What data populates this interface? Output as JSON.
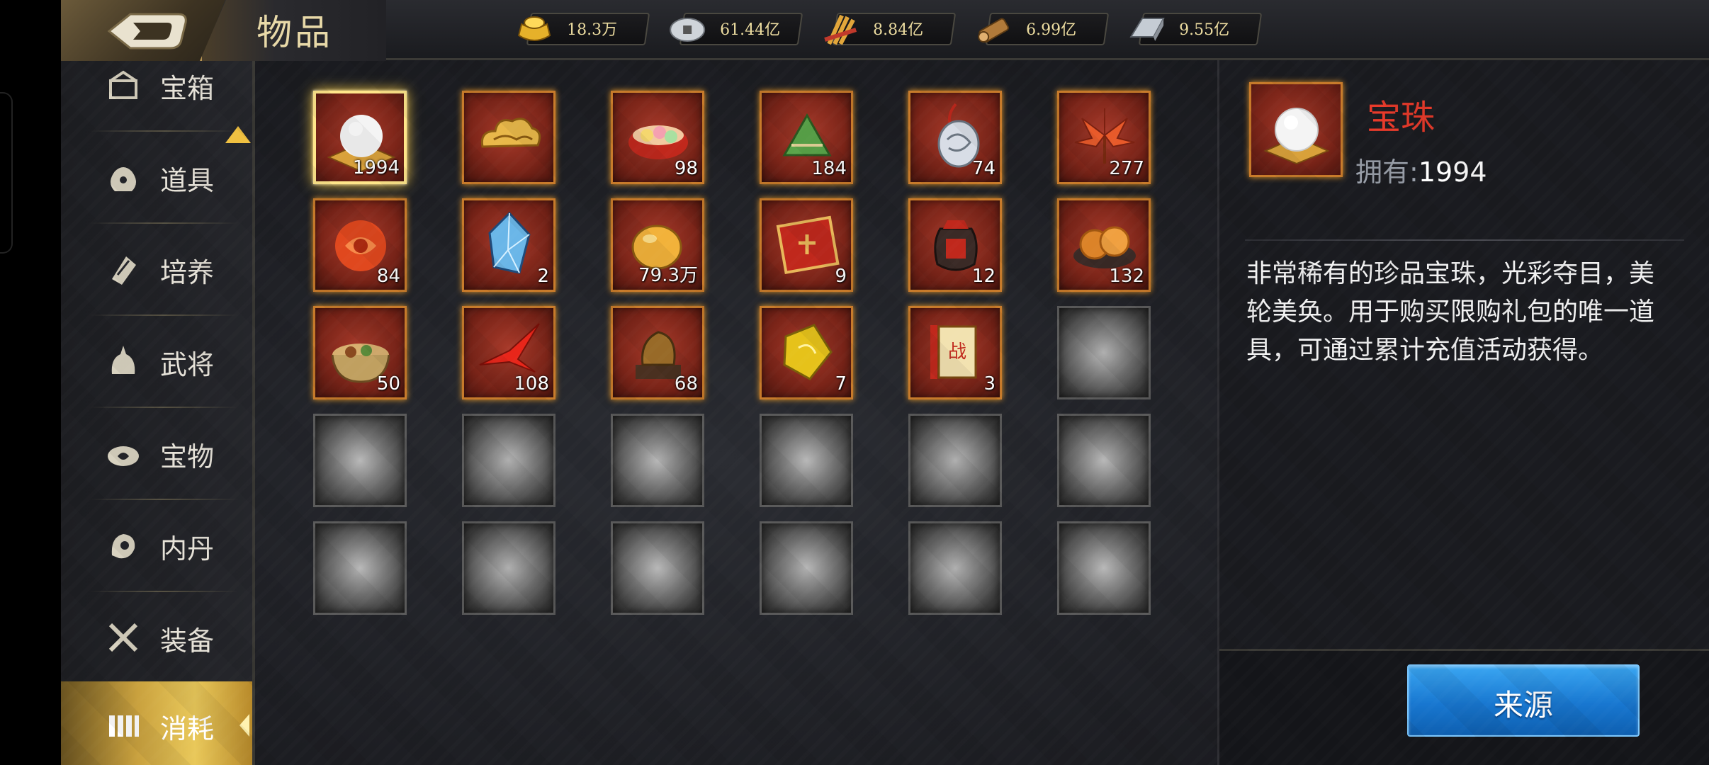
{
  "header": {
    "title": "物品",
    "resources": [
      {
        "icon": "gold-ingot-icon",
        "value": "18.3万"
      },
      {
        "icon": "silver-coin-icon",
        "value": "61.44亿"
      },
      {
        "icon": "grain-icon",
        "value": "8.84亿"
      },
      {
        "icon": "wood-icon",
        "value": "6.99亿"
      },
      {
        "icon": "iron-icon",
        "value": "9.55亿"
      }
    ]
  },
  "sidebar": {
    "items": [
      {
        "label": "宝箱",
        "icon": "chest-icon"
      },
      {
        "label": "道具",
        "icon": "pouch-icon"
      },
      {
        "label": "培养",
        "icon": "scroll-icon"
      },
      {
        "label": "武将",
        "icon": "helmet-icon"
      },
      {
        "label": "宝物",
        "icon": "treasure-icon"
      },
      {
        "label": "内丹",
        "icon": "elixir-icon"
      },
      {
        "label": "装备",
        "icon": "swords-icon"
      },
      {
        "label": "消耗",
        "icon": "consumable-icon",
        "active": true
      }
    ]
  },
  "grid": {
    "items": [
      {
        "name": "pearl",
        "count": "1994",
        "selected": true
      },
      {
        "name": "cloud",
        "count": ""
      },
      {
        "name": "rice-balls",
        "count": "98"
      },
      {
        "name": "zongzi",
        "count": "184"
      },
      {
        "name": "jade-pendant",
        "count": "74"
      },
      {
        "name": "red-leaf",
        "count": "277"
      },
      {
        "name": "red-gem",
        "count": "84"
      },
      {
        "name": "blue-crystal",
        "count": "2"
      },
      {
        "name": "gold-seed",
        "count": "79.3万"
      },
      {
        "name": "red-card",
        "count": "9"
      },
      {
        "name": "wine-jar",
        "count": "12"
      },
      {
        "name": "mooncakes",
        "count": "132"
      },
      {
        "name": "stew-pot",
        "count": "50"
      },
      {
        "name": "paper-crane",
        "count": "108"
      },
      {
        "name": "dragon-seal",
        "count": "68"
      },
      {
        "name": "gold-stone",
        "count": "7"
      },
      {
        "name": "war-scroll",
        "count": "3"
      }
    ],
    "total_slots": 30
  },
  "detail": {
    "name": "宝珠",
    "own_label": "拥有:",
    "own_value": "1994",
    "description": "非常稀有的珍品宝珠，光彩夺目，美轮美奂。用于购买限购礼包的唯一道具，可通过累计充值活动获得。",
    "source_button": "来源"
  },
  "colors": {
    "item_name": "#e83a2a",
    "source_button": "#1877d0",
    "active_tab": "#c9a13e"
  }
}
